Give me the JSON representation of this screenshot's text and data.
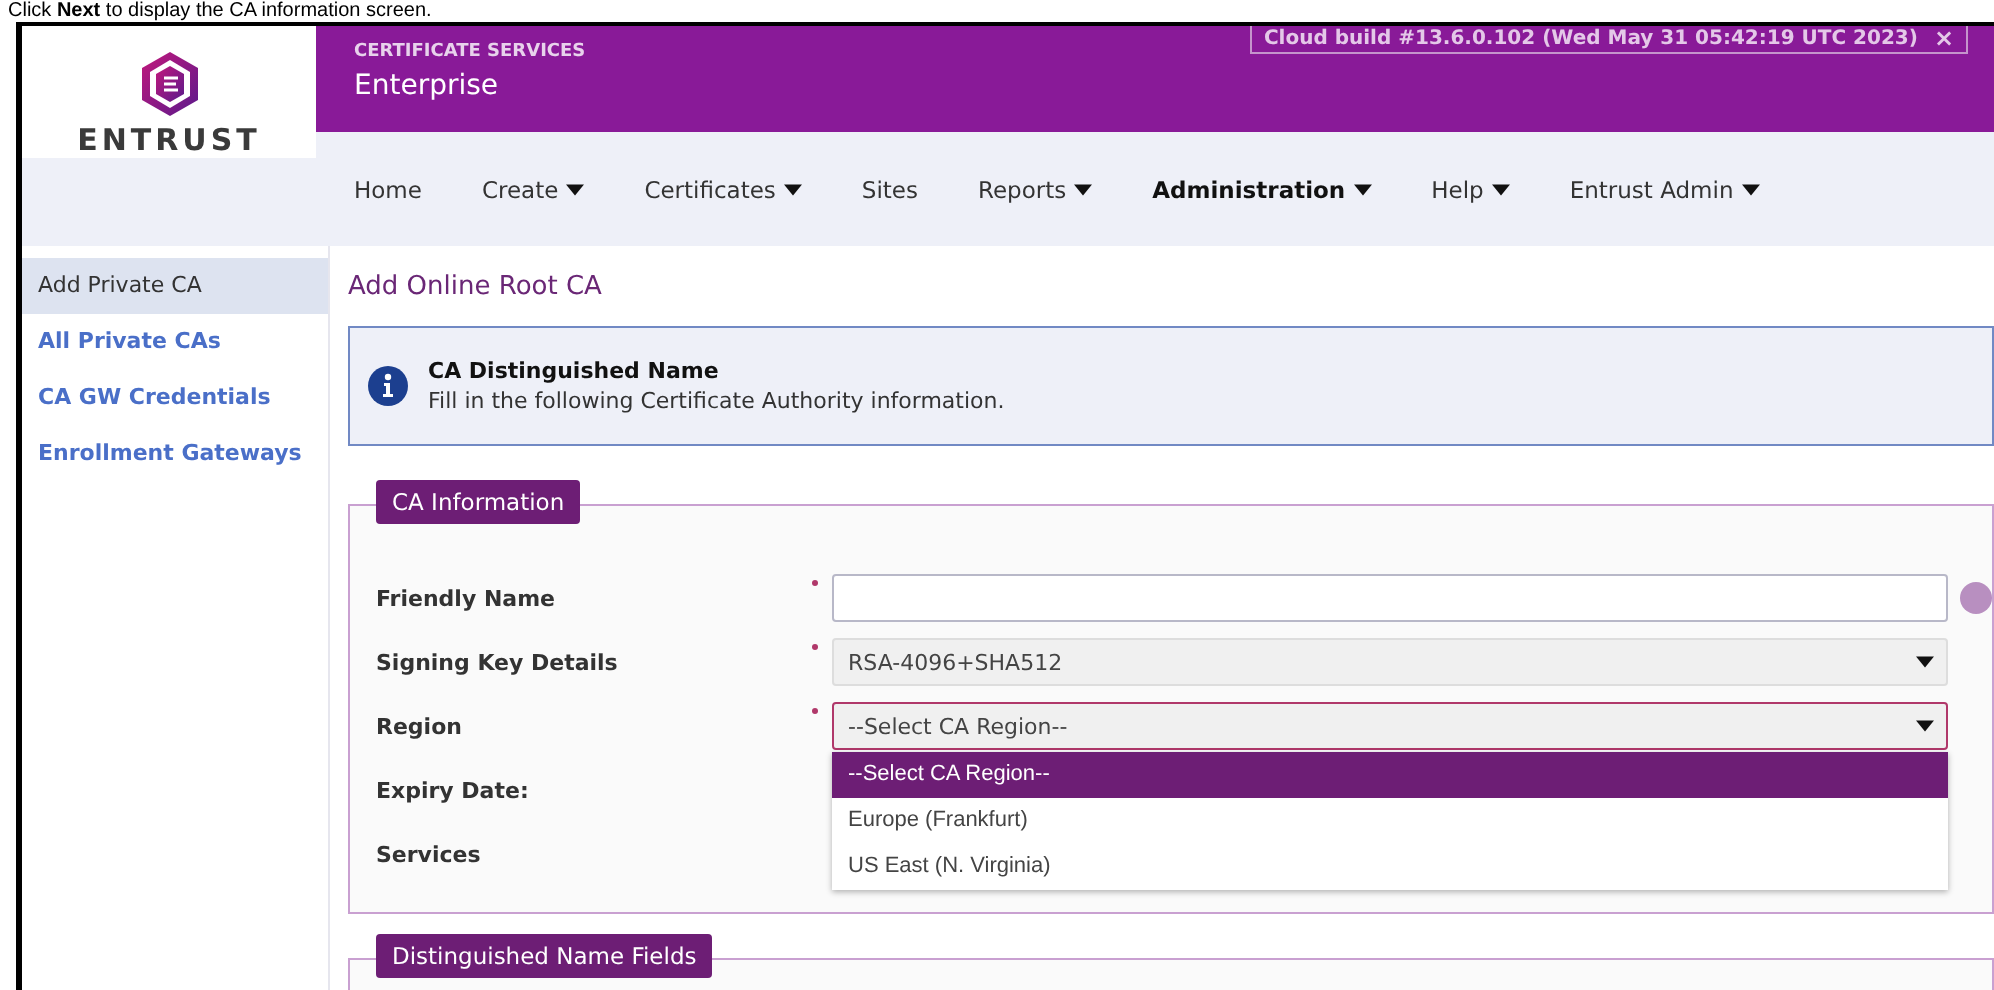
{
  "caption": "Click **Next** to display the CA information screen.",
  "logo": {
    "text": "ENTRUST"
  },
  "header": {
    "subtitle": "CERTIFICATE SERVICES",
    "title": "Enterprise",
    "build_notice": "Cloud build #13.6.0.102 (Wed May 31 05:42:19 UTC 2023)",
    "close": "×"
  },
  "nav": [
    {
      "label": "Home",
      "dropdown": false,
      "selected": false
    },
    {
      "label": "Create",
      "dropdown": true,
      "selected": false
    },
    {
      "label": "Certificates",
      "dropdown": true,
      "selected": false
    },
    {
      "label": "Sites",
      "dropdown": false,
      "selected": false
    },
    {
      "label": "Reports",
      "dropdown": true,
      "selected": false
    },
    {
      "label": "Administration",
      "dropdown": true,
      "selected": true
    },
    {
      "label": "Help",
      "dropdown": true,
      "selected": false
    },
    {
      "label": "Entrust Admin",
      "dropdown": true,
      "selected": false
    }
  ],
  "sidebar": {
    "items": [
      {
        "label": "Add Private CA",
        "selected": true
      },
      {
        "label": "All Private CAs",
        "selected": false
      },
      {
        "label": "CA GW Credentials",
        "selected": false
      },
      {
        "label": "Enrollment Gateways",
        "selected": false
      }
    ]
  },
  "page_title": "Add Online Root CA",
  "info": {
    "title": "CA Distinguished Name",
    "text": "Fill in the following Certificate Authority information."
  },
  "sections": [
    {
      "legend": "CA Information",
      "fields": [
        {
          "label": "Friendly Name",
          "kind": "text",
          "required": true,
          "help": true
        },
        {
          "label": "Signing Key Details",
          "kind": "select",
          "required": true,
          "value": "RSA-4096+SHA512",
          "focused": false
        },
        {
          "label": "Region",
          "kind": "select",
          "required": true,
          "value": "--Select CA Region--",
          "focused": true,
          "expanded": true,
          "options": [
            {
              "label": "--Select CA Region--",
              "selected": true
            },
            {
              "label": "Europe (Frankfurt)",
              "selected": false
            },
            {
              "label": "US East (N. Virginia)",
              "selected": false
            }
          ]
        },
        {
          "label": "Expiry Date:",
          "kind": "none"
        },
        {
          "label": "Services",
          "kind": "none"
        }
      ]
    },
    {
      "legend": "Distinguished Name Fields"
    }
  ]
}
